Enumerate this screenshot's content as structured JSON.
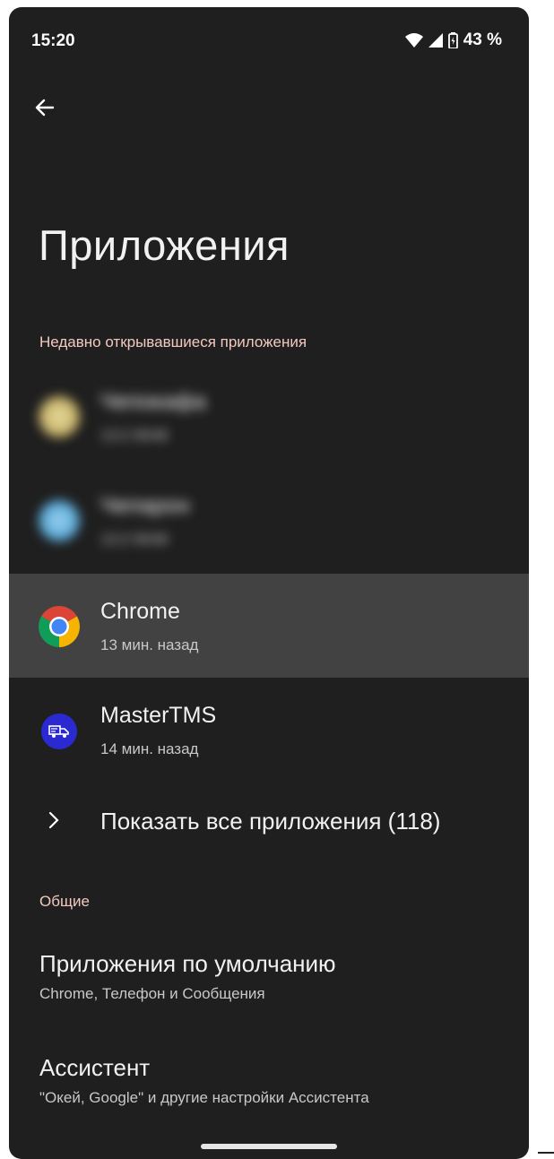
{
  "status_bar": {
    "time": "15:20",
    "battery_text": "43 %"
  },
  "header": {
    "title": "Приложения"
  },
  "recent_section": {
    "header": "Недавно открывавшиеся приложения",
    "apps": [
      {
        "name": "Чепокафа",
        "time": "13:2 8048",
        "icon": "yellow-app-icon",
        "blurred": true
      },
      {
        "name": "Чепарон",
        "time": "13:2 8048",
        "icon": "blue-app-icon",
        "blurred": true
      },
      {
        "name": "Chrome",
        "time": "13 мин. назад",
        "icon": "chrome-icon"
      },
      {
        "name": "MasterTMS",
        "time": "14 мин. назад",
        "icon": "mastertms-icon"
      }
    ],
    "show_all_label": "Показать все приложения (118)"
  },
  "general_section": {
    "header": "Общие",
    "items": [
      {
        "title": "Приложения по умолчанию",
        "subtitle": "Chrome, Телефон и Сообщения"
      },
      {
        "title": "Ассистент",
        "subtitle": "\"Окей, Google\" и другие настройки Ассистента"
      }
    ]
  },
  "colors": {
    "background": "#1f1f1f",
    "accent_header": "#f2c9c0",
    "highlight": "#424242"
  }
}
